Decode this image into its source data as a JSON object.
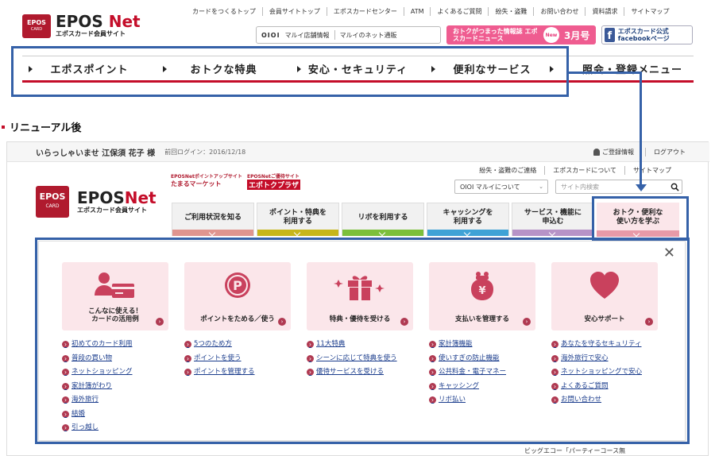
{
  "old": {
    "logo_card": "EPOS",
    "logo_card_sub": "CARD",
    "logo_title_a": "EPOS ",
    "logo_title_b": "Net",
    "logo_sub": "エポスカード会員サイト",
    "top_links": [
      "カードをつくるトップ",
      "会員サイトトップ",
      "エポスカードセンター",
      "ATM",
      "よくあるご質問",
      "紛失・盗難",
      "お問い合わせ",
      "資料請求",
      "サイトマップ"
    ],
    "marui_logo": "OIOI",
    "marui_link1": "マルイ店舗情報",
    "marui_link2": "マルイのネット通販",
    "news_text": "おトクがつまった情報誌 エポスカードニュース",
    "news_badge": "New",
    "news_month": "3月号",
    "fb_text": "エポスカード公式 facebookページ",
    "nav": [
      "エポスポイント",
      "おトクな特典",
      "安心・セキュリティ",
      "便利なサービス",
      "照会・登録メニュー"
    ]
  },
  "section_label": "リニューアル後",
  "new": {
    "welcome": "いらっしゃいませ 江保須 花子 様",
    "last_login": "前回ログイン：2016/12/18",
    "registered_info": "ご登録情報",
    "logout": "ログアウト",
    "sub_links": [
      "紛失・盗難のご連絡",
      "エポスカードについて",
      "サイトマップ"
    ],
    "promo1_small": "EPOSNetポイントアップサイト",
    "promo1_main": "たまるマーケット",
    "promo2_small": "EPOSNetご優待サイト",
    "promo2_main": "エポトクプラザ",
    "marui_select": "OIOI マルイについて",
    "search_placeholder": "サイト内検索",
    "logo_card": "EPOS",
    "logo_card_sub": "CARD",
    "logo_title_a": "EPOS",
    "logo_title_b": "Net",
    "logo_sub": "エポスカード会員サイト",
    "tabs": [
      {
        "label": "ご利用状況を知る",
        "color": "#e0958f"
      },
      {
        "label": "ポイント・特典を\n利用する",
        "color": "#c7b61a"
      },
      {
        "label": "リボを利用する",
        "color": "#7cbf3a"
      },
      {
        "label": "キャッシングを\n利用する",
        "color": "#3fa2d6"
      },
      {
        "label": "サービス・機能に\n申込む",
        "color": "#b793c7"
      },
      {
        "label": "おトク・便利な\n使い方を学ぶ",
        "color": "#e89aa8"
      }
    ],
    "mega": {
      "columns": [
        {
          "title": "こんなに使える！\nカードの活用例",
          "links": [
            "初めてのカード利用",
            "普段の買い物",
            "ネットショッピング",
            "家計簿がわり",
            "海外旅行",
            "結婚",
            "引っ越し"
          ]
        },
        {
          "title": "ポイントをためる／使う",
          "links": [
            "5つのため方",
            "ポイントを使う",
            "ポイントを管理する"
          ]
        },
        {
          "title": "特典・優待を受ける",
          "links": [
            "11大特典",
            "シーンに応じて特典を使う",
            "優待サービスを受ける"
          ]
        },
        {
          "title": "支払いを管理する",
          "links": [
            "家計簿機能",
            "使いすぎの防止機能",
            "公共料金・電子マネー",
            "キャッシング",
            "リボ払い"
          ]
        },
        {
          "title": "安心サポート",
          "links": [
            "あなたを守るセキュリティ",
            "海外旅行で安心",
            "ネットショッピングで安心",
            "よくあるご質問",
            "お問い合わせ"
          ]
        }
      ]
    },
    "bottom_partial": "ビッグエコー「パーティーコース無"
  },
  "colors": {
    "brand_red": "#c40d29",
    "highlight_blue": "#3561a8",
    "menu_pink": "#fbe6ea"
  }
}
